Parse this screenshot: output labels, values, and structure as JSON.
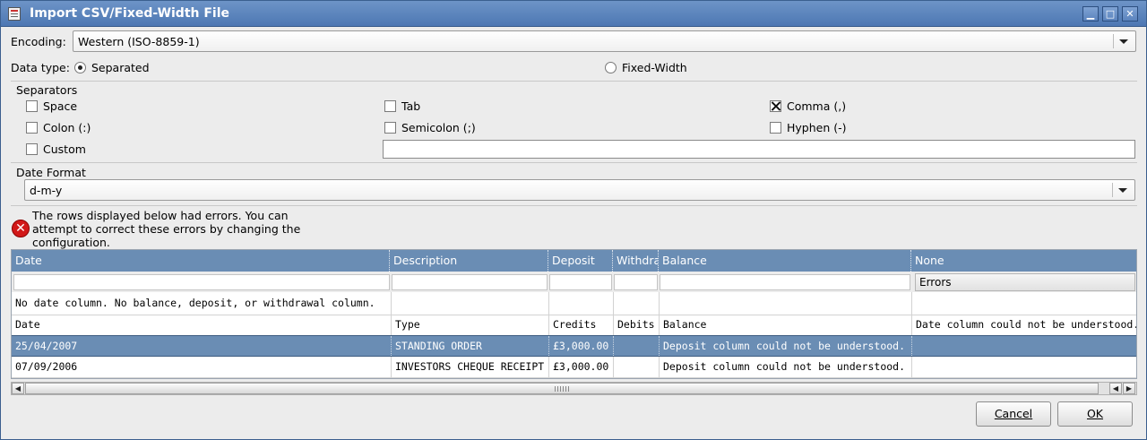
{
  "window": {
    "title": "Import CSV/Fixed-Width File",
    "min_glyph": "▁",
    "max_glyph": "□",
    "close_glyph": "✕"
  },
  "encoding": {
    "label": "Encoding:",
    "value": "Western (ISO-8859-1)"
  },
  "data_type": {
    "label": "Data type:",
    "separated": "Separated",
    "fixed_width": "Fixed-Width",
    "selected": "Separated"
  },
  "separators": {
    "heading": "Separators",
    "space": "Space",
    "tab": "Tab",
    "comma": "Comma (,)",
    "colon": "Colon (:)",
    "semicolon": "Semicolon (;)",
    "hyphen": "Hyphen (-)",
    "custom": "Custom",
    "custom_value": "",
    "checked": [
      "Comma (,)"
    ]
  },
  "date_format": {
    "label": "Date Format",
    "value": "d-m-y"
  },
  "error": {
    "icon": "error-icon",
    "glyph": "✕",
    "message": "The rows displayed below had errors. You can attempt to correct these errors by changing the configuration."
  },
  "grid": {
    "columns": [
      "Date",
      "Description",
      "Deposit",
      "Withdrawal",
      "Balance",
      "None"
    ],
    "errors_header": "Errors",
    "warning": "No date column. No balance, deposit, or withdrawal column.",
    "title_row": [
      "Date",
      "Type",
      "Credits",
      "Debits",
      "Balance",
      "Date column could not be understood."
    ],
    "rows": [
      {
        "date": "25/04/2007",
        "type": "STANDING ORDER",
        "credit": "£3,000.00",
        "debit": "",
        "balance": "Deposit column could not be understood.",
        "error": "",
        "selected": true
      },
      {
        "date": "07/09/2006",
        "type": "INVESTORS CHEQUE RECEIPT",
        "credit": "£3,000.00",
        "debit": "",
        "balance": "Deposit column could not be understood.",
        "error": "",
        "selected": false
      }
    ]
  },
  "scrollbar": {
    "left_glyph": "◀",
    "right_glyph": "▶"
  },
  "buttons": {
    "cancel": "Cancel",
    "ok": "OK"
  },
  "colors": {
    "title_bar": "#5a83bd",
    "selection": "#6a8db4",
    "error": "#d21818"
  }
}
